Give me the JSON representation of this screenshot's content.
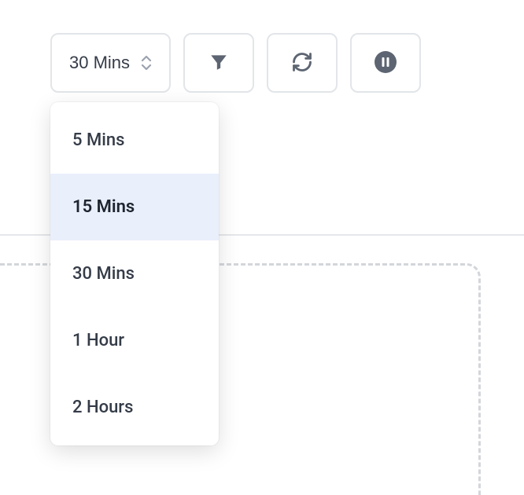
{
  "toolbar": {
    "time_select": {
      "selected_label": "30 Mins",
      "options": [
        {
          "label": "5 Mins"
        },
        {
          "label": "15 Mins"
        },
        {
          "label": "30 Mins"
        },
        {
          "label": "1 Hour"
        },
        {
          "label": "2 Hours"
        }
      ],
      "hovered_index": 1
    },
    "icons": {
      "filter": "filter-icon",
      "refresh": "refresh-icon",
      "pause": "pause-icon"
    }
  }
}
